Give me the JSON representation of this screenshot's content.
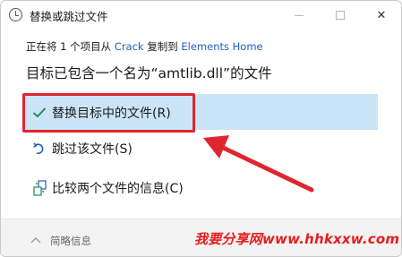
{
  "window": {
    "title": "替换或跳过文件",
    "minimize_icon": "minimize-icon",
    "maximize_icon": "maximize-icon",
    "close_glyph": "✕"
  },
  "source": {
    "prefix": "正在将 1 个项目从",
    "from": "Crack",
    "middle": "复制到",
    "to": "Elements Home"
  },
  "heading": "目标已包含一个名为“amtlib.dll”的文件",
  "options": [
    {
      "label": "替换目标中的文件(R)",
      "icon": "check-icon",
      "selected": true
    },
    {
      "label": "跳过该文件(S)",
      "icon": "skip-arrow-icon",
      "selected": false
    },
    {
      "label": "比较两个文件的信息(C)",
      "icon": "compare-icon",
      "selected": false
    }
  ],
  "footer": {
    "details_label": "简略信息",
    "watermark": "我要分享网www.hhkxxw.com"
  },
  "colors": {
    "accent": "#1f5fbf",
    "selected_bg": "#cce4f7",
    "annotation_red": "#e0262f",
    "check_green": "#1e8f5a"
  }
}
